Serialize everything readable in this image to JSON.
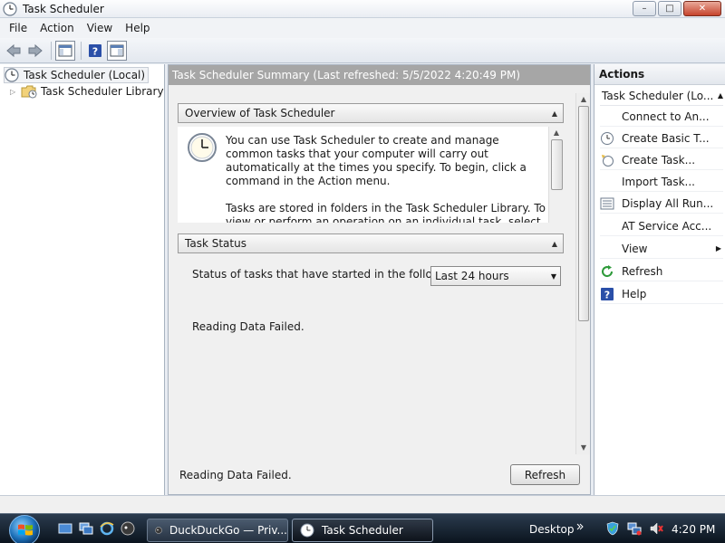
{
  "window": {
    "title": "Task Scheduler",
    "buttons": {
      "minimize": "–",
      "maximize": "□",
      "close": "✕"
    }
  },
  "menu": {
    "items": [
      {
        "label": "File"
      },
      {
        "label": "Action"
      },
      {
        "label": "View"
      },
      {
        "label": "Help"
      }
    ]
  },
  "toolbar": {
    "icons": [
      "back-arrow-icon",
      "forward-arrow-icon",
      "show-hide-console-tree-icon",
      "help-icon",
      "show-hide-action-pane-icon"
    ]
  },
  "tree": {
    "root": {
      "label": "Task Scheduler (Local)"
    },
    "library": {
      "label": "Task Scheduler Library"
    }
  },
  "center": {
    "header": "Task Scheduler Summary (Last refreshed: 5/5/2022 4:20:49 PM)",
    "overview": {
      "title": "Overview of Task Scheduler",
      "paragraph1": "You can use Task Scheduler to create and manage common tasks that your computer will carry out automatically at the times you specify. To begin, click a command in the Action menu.",
      "paragraph2": "Tasks are stored in folders in the Task Scheduler Library. To view or perform an operation on an individual task, select the task in"
    },
    "task_status": {
      "title": "Task Status",
      "label": "Status of tasks that have started in the followi...",
      "select_value": "Last 24 hours",
      "message": "Reading Data Failed."
    },
    "footer": {
      "message": "Reading Data Failed.",
      "refresh_label": "Refresh"
    }
  },
  "actions": {
    "header": "Actions",
    "group": "Task Scheduler  (Lo...",
    "items": [
      {
        "label": "Connect to An...",
        "icon": "none"
      },
      {
        "label": "Create Basic T...",
        "icon": "create-basic-task-icon"
      },
      {
        "label": "Create Task...",
        "icon": "create-task-icon"
      },
      {
        "label": "Import Task...",
        "icon": "none"
      },
      {
        "label": "Display All Run...",
        "icon": "display-running-tasks-icon"
      },
      {
        "label": "AT Service Acc...",
        "icon": "none"
      },
      {
        "label": "View",
        "icon": "none",
        "submenu": true
      },
      {
        "label": "Refresh",
        "icon": "refresh-icon"
      },
      {
        "label": "Help",
        "icon": "help-icon"
      }
    ]
  },
  "taskbar": {
    "tasks": [
      {
        "label": "DuckDuckGo — Priv...",
        "icon": "duckduckgo-icon",
        "active": false
      },
      {
        "label": "Task Scheduler",
        "icon": "task-scheduler-icon",
        "active": true
      }
    ],
    "desktop_label": "Desktop",
    "clock": "4:20 PM"
  },
  "colors": {
    "center_header_bg": "#a6a6a6",
    "taskbar_bg": "#0b141e",
    "close_button": "#c6432c"
  }
}
